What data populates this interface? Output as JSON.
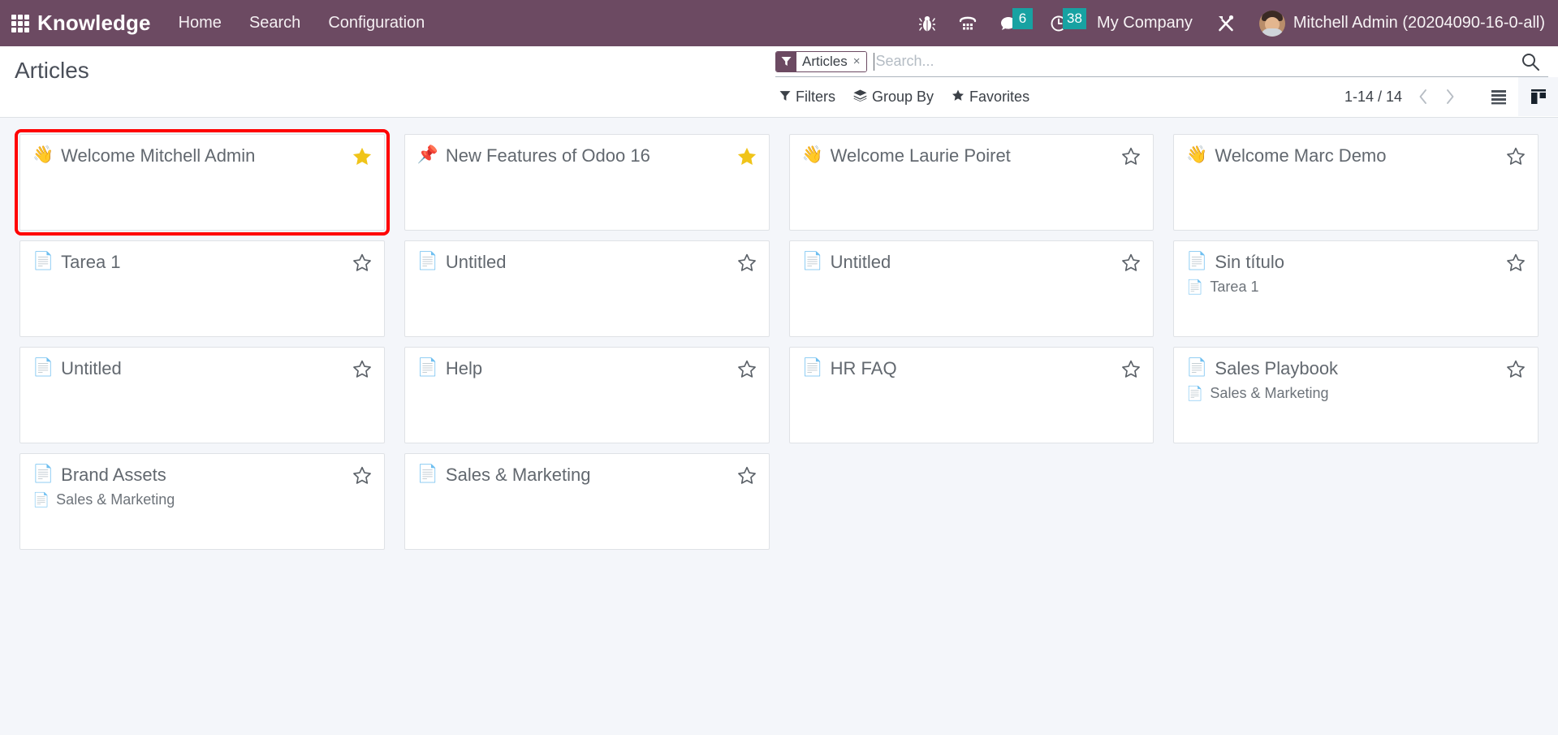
{
  "navbar": {
    "apps_icon": "grid-apps-icon",
    "brand": "Knowledge",
    "menu": [
      {
        "label": "Home",
        "name": "nav-menu-home"
      },
      {
        "label": "Search",
        "name": "nav-menu-search"
      },
      {
        "label": "Configuration",
        "name": "nav-menu-configuration"
      }
    ],
    "icons": [
      {
        "name": "bug-icon",
        "badge": null
      },
      {
        "name": "phone-dialpad-icon",
        "badge": null
      },
      {
        "name": "messages-icon",
        "badge": "6"
      },
      {
        "name": "activities-clock-icon",
        "badge": "38"
      }
    ],
    "company": "My Company",
    "tools_icon": "wrench-screwdriver-icon",
    "user": "Mitchell Admin (20204090-16-0-all)",
    "colors": {
      "background": "#6C4A62",
      "badge": "#17A2A2",
      "text": "#FFFFFF"
    }
  },
  "control_panel": {
    "title": "Articles",
    "search": {
      "facet_label": "Articles",
      "facet_remove": "×",
      "facet_icon": "filter-funnel-icon",
      "placeholder": "Search...",
      "value": "",
      "magnifier_icon": "search-icon"
    },
    "toggles": [
      {
        "label": "Filters",
        "icon": "filter-funnel-icon",
        "name": "filters-dropdown"
      },
      {
        "label": "Group By",
        "icon": "layers-icon",
        "name": "group-by-dropdown"
      },
      {
        "label": "Favorites",
        "icon": "star-icon",
        "name": "favorites-dropdown"
      }
    ],
    "pager": "1-14 / 14",
    "prev_icon": "chevron-left-icon",
    "next_icon": "chevron-right-icon",
    "views": [
      {
        "name": "list-view-button",
        "icon": "list-icon",
        "active": false
      },
      {
        "name": "kanban-view-button",
        "icon": "kanban-icon",
        "active": true
      }
    ]
  },
  "kanban": {
    "cards": [
      {
        "icon": "👋",
        "icon_name": "waving-hand-emoji",
        "title": "Welcome Mitchell Admin",
        "favorite": true,
        "highlighted": true,
        "child": null
      },
      {
        "icon": "📌",
        "icon_name": "pushpin-emoji",
        "title": "New Features of Odoo 16",
        "favorite": true,
        "highlighted": false,
        "child": null
      },
      {
        "icon": "👋",
        "icon_name": "waving-hand-emoji",
        "title": "Welcome Laurie Poiret",
        "favorite": false,
        "highlighted": false,
        "child": null
      },
      {
        "icon": "👋",
        "icon_name": "waving-hand-emoji",
        "title": "Welcome Marc Demo",
        "favorite": false,
        "highlighted": false,
        "child": null
      },
      {
        "icon": "📄",
        "icon_name": "document-emoji",
        "title": "Tarea 1",
        "favorite": false,
        "highlighted": false,
        "child": null
      },
      {
        "icon": "📄",
        "icon_name": "document-emoji",
        "title": "Untitled",
        "favorite": false,
        "highlighted": false,
        "child": null
      },
      {
        "icon": "📄",
        "icon_name": "document-emoji",
        "title": "Untitled",
        "favorite": false,
        "highlighted": false,
        "child": null
      },
      {
        "icon": "📄",
        "icon_name": "document-emoji",
        "title": "Sin título",
        "favorite": false,
        "highlighted": false,
        "child": {
          "icon": "📄",
          "title": "Tarea 1"
        }
      },
      {
        "icon": "📄",
        "icon_name": "document-emoji",
        "title": "Untitled",
        "favorite": false,
        "highlighted": false,
        "child": null
      },
      {
        "icon": "📄",
        "icon_name": "document-emoji",
        "title": "Help",
        "favorite": false,
        "highlighted": false,
        "child": null
      },
      {
        "icon": "📄",
        "icon_name": "document-emoji",
        "title": "HR FAQ",
        "favorite": false,
        "highlighted": false,
        "child": null
      },
      {
        "icon": "📄",
        "icon_name": "document-emoji",
        "title": "Sales Playbook",
        "favorite": false,
        "highlighted": false,
        "child": {
          "icon": "📄",
          "title": "Sales & Marketing"
        }
      },
      {
        "icon": "📄",
        "icon_name": "document-emoji",
        "title": "Brand Assets",
        "favorite": false,
        "highlighted": false,
        "child": {
          "icon": "📄",
          "title": "Sales & Marketing"
        }
      },
      {
        "icon": "📄",
        "icon_name": "document-emoji",
        "title": "Sales & Marketing",
        "favorite": false,
        "highlighted": false,
        "child": null
      }
    ],
    "star_filled_color": "#F0C419",
    "star_empty_color": "#5b6168"
  }
}
